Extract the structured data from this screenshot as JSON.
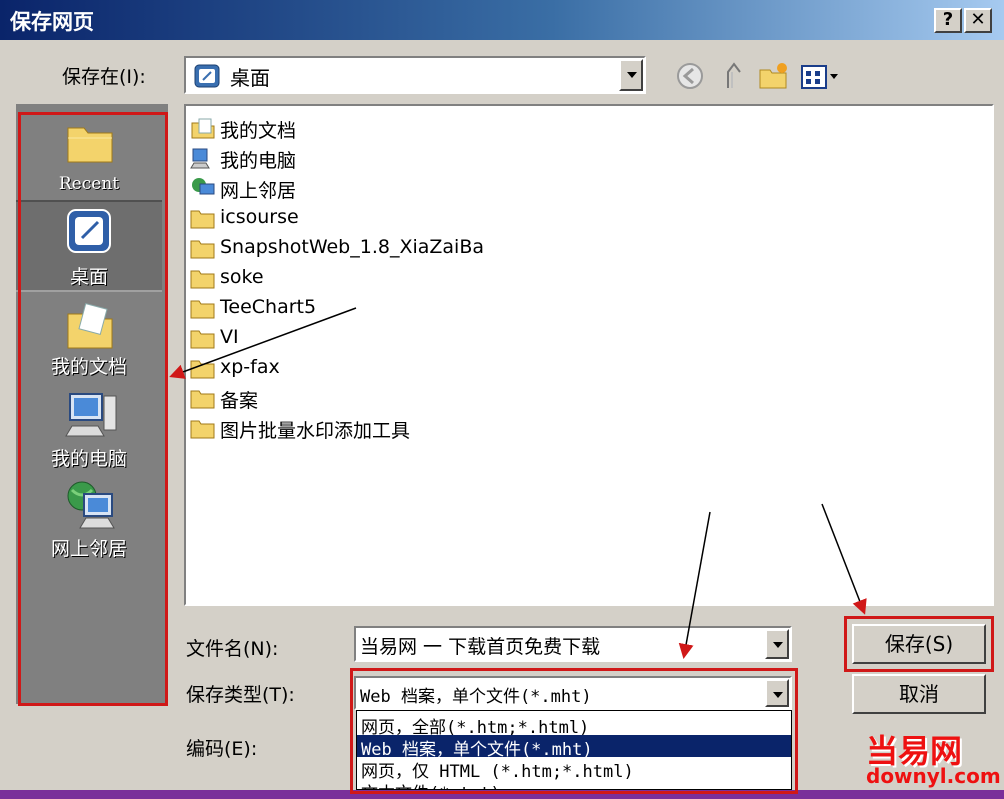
{
  "window": {
    "title": "保存网页",
    "help": "?",
    "close": "✕"
  },
  "save_in": {
    "label": "保存在(I):",
    "value": "桌面"
  },
  "toolbar": {
    "icons": [
      "back-icon",
      "up-folder-icon",
      "new-folder-icon",
      "view-menu-icon"
    ]
  },
  "places": [
    {
      "label": "Recent",
      "icon": "folder-icon"
    },
    {
      "label": "桌面",
      "icon": "desktop-icon"
    },
    {
      "label": "我的文档",
      "icon": "my-documents-icon"
    },
    {
      "label": "我的电脑",
      "icon": "my-computer-icon"
    },
    {
      "label": "网上邻居",
      "icon": "network-icon"
    }
  ],
  "files": [
    {
      "name": "我的文档",
      "icon": "my-documents-icon"
    },
    {
      "name": "我的电脑",
      "icon": "my-computer-icon"
    },
    {
      "name": "网上邻居",
      "icon": "network-icon"
    },
    {
      "name": "icsourse",
      "icon": "folder-icon"
    },
    {
      "name": "SnapshotWeb_1.8_XiaZaiBa",
      "icon": "folder-icon"
    },
    {
      "name": "soke",
      "icon": "folder-icon"
    },
    {
      "name": "TeeChart5",
      "icon": "folder-icon"
    },
    {
      "name": "VI",
      "icon": "folder-icon"
    },
    {
      "name": "xp-fax",
      "icon": "folder-icon"
    },
    {
      "name": "备案",
      "icon": "folder-icon"
    },
    {
      "name": "图片批量水印添加工具",
      "icon": "folder-icon"
    }
  ],
  "filename": {
    "label": "文件名(N):",
    "value": "当易网 一 下载首页免费下载"
  },
  "filetype": {
    "label": "保存类型(T):",
    "value": "Web 档案，单个文件(*.mht)",
    "options": [
      "网页，全部(*.htm;*.html)",
      "Web 档案，单个文件(*.mht)",
      "网页，仅 HTML (*.htm;*.html)",
      "文本文件(*.txt)"
    ],
    "selected_index": 1
  },
  "encoding": {
    "label": "编码(E):"
  },
  "buttons": {
    "save": "保存(S)",
    "cancel": "取消"
  },
  "watermark": {
    "line1": "当易网",
    "line2": "downyl.com"
  },
  "colors": {
    "highlight": "#d01818",
    "selection": "#0a246a"
  }
}
